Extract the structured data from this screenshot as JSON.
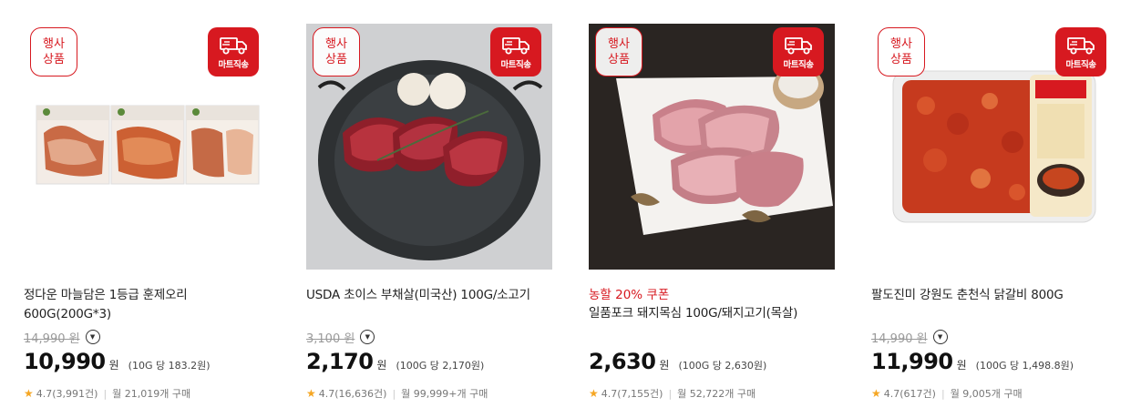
{
  "products": [
    {
      "event_badge": "행사\n상품",
      "event_line1": "행사",
      "event_line2": "상품",
      "mart_badge": "마트직송",
      "coupon": "",
      "name": "정다운 마늘담은 1등급 훈제오리 600G(200G*3)",
      "original_price": "14,990 원",
      "price": "10,990",
      "currency": "원",
      "unit_price": "(10G 당 183.2원)",
      "rating": "4.7(3,991건)",
      "monthly_sales": "월 21,019개 구매"
    },
    {
      "event_line1": "행사",
      "event_line2": "상품",
      "mart_badge": "마트직송",
      "coupon": "",
      "name": "USDA 초이스 부채살(미국산) 100G/소고기",
      "original_price": "3,100 원",
      "price": "2,170",
      "currency": "원",
      "unit_price": "(100G 당 2,170원)",
      "rating": "4.7(16,636건)",
      "monthly_sales": "월 99,999+개 구매"
    },
    {
      "event_line1": "행사",
      "event_line2": "상품",
      "mart_badge": "마트직송",
      "coupon": "농할 20% 쿠폰",
      "name": "일품포크 돼지목심 100G/돼지고기(목살)",
      "original_price": "",
      "price": "2,630",
      "currency": "원",
      "unit_price": "(100G 당 2,630원)",
      "rating": "4.7(7,155건)",
      "monthly_sales": "월 52,722개 구매"
    },
    {
      "event_line1": "행사",
      "event_line2": "상품",
      "mart_badge": "마트직송",
      "coupon": "",
      "name": "팔도진미 강원도 춘천식 닭갈비 800G",
      "original_price": "14,990 원",
      "price": "11,990",
      "currency": "원",
      "unit_price": "(100G 당 1,498.8원)",
      "rating": "4.7(617건)",
      "monthly_sales": "월 9,005개 구매"
    }
  ],
  "icons": {
    "mart_truck": "truck-icon",
    "star": "star-icon",
    "more": "chevron-down-icon"
  },
  "colors": {
    "accent": "#d71920",
    "star": "#f5a623"
  },
  "rating_star": "★",
  "more_glyph": "▼",
  "separator": "|"
}
